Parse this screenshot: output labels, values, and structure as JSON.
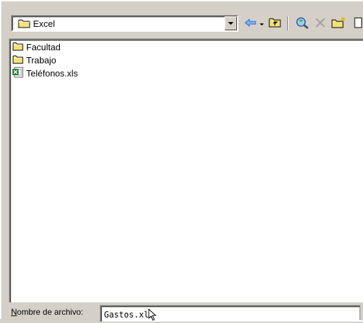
{
  "toolbar": {
    "location_value": "Excel",
    "icons": [
      "folder-icon",
      "chevron-down-icon",
      "back-arrow-icon",
      "up-folder-icon",
      "search-web-icon",
      "delete-icon",
      "new-folder-icon"
    ]
  },
  "files": [
    {
      "name": "Facultad",
      "type": "folder"
    },
    {
      "name": "Trabajo",
      "type": "folder"
    },
    {
      "name": "Teléfonos.xls",
      "type": "excel"
    }
  ],
  "filename": {
    "label_first": "N",
    "label_rest": "ombre de archivo:",
    "value": "Gastos.xls"
  },
  "colors": {
    "window_bg": "#d4d0c8",
    "folder_yellow": "#f4e17a",
    "excel_green": "#1e7b34",
    "arrow_blue": "#2f6bd6"
  }
}
